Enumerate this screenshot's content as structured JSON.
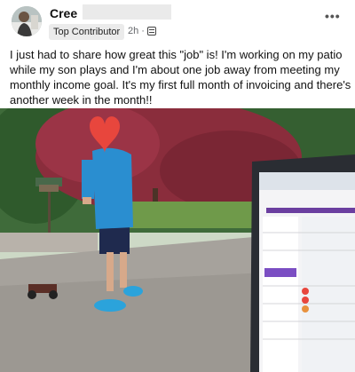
{
  "post": {
    "author": "Cree",
    "badge": "Top Contributor",
    "time": "2h ·",
    "privacy_icon": "audience-icon",
    "more_icon": "more-options-icon",
    "text": "I just had to share how great this \"job\" is! I'm working on my patio while my son plays and I'm about one job away from meeting my monthly income goal. It's my first full month of invoicing and there's another week in the month!!"
  },
  "colors": {
    "sky": "#cfe0cf",
    "maple": "#8a2d3c",
    "driveway": "#a6a29c",
    "shirt": "#2a8ed0",
    "heart": "#e8463d"
  }
}
